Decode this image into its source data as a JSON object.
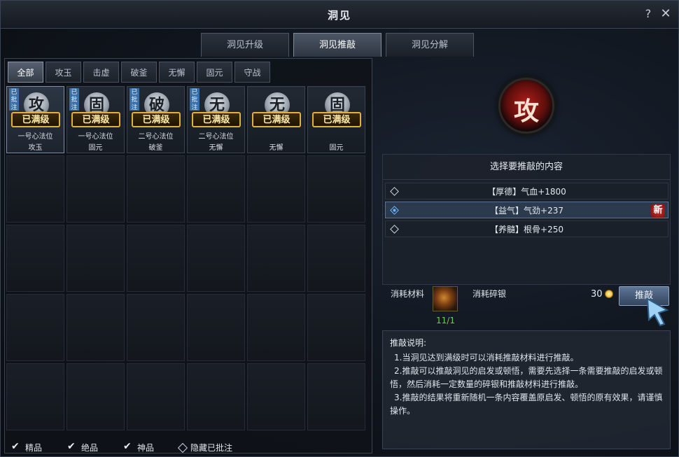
{
  "window": {
    "title": "洞见",
    "help": "?",
    "close": "✕"
  },
  "main_tabs": [
    {
      "label": "洞见升级",
      "active": false
    },
    {
      "label": "洞见推敲",
      "active": true
    },
    {
      "label": "洞见分解",
      "active": false
    }
  ],
  "category_tabs": [
    {
      "label": "全部",
      "active": true
    },
    {
      "label": "攻玉",
      "active": false
    },
    {
      "label": "击虚",
      "active": false
    },
    {
      "label": "破釜",
      "active": false
    },
    {
      "label": "无懈",
      "active": false
    },
    {
      "label": "固元",
      "active": false
    },
    {
      "label": "守战",
      "active": false
    }
  ],
  "items": [
    {
      "glyph": "攻",
      "annotated": true,
      "annot_tag": "已批注",
      "badge": "已满级",
      "slot": "一号心法位",
      "category": "攻玉",
      "selected": true
    },
    {
      "glyph": "固",
      "annotated": true,
      "annot_tag": "已批注",
      "badge": "已满级",
      "slot": "一号心法位",
      "category": "固元",
      "selected": false
    },
    {
      "glyph": "破",
      "annotated": true,
      "annot_tag": "已批注",
      "badge": "已满级",
      "slot": "二号心法位",
      "category": "破釜",
      "selected": false
    },
    {
      "glyph": "无",
      "annotated": true,
      "annot_tag": "已批注",
      "badge": "已满级",
      "slot": "二号心法位",
      "category": "无懈",
      "selected": false
    },
    {
      "glyph": "无",
      "annotated": false,
      "annot_tag": "",
      "badge": "已满级",
      "slot": "",
      "category": "无懈",
      "selected": false
    },
    {
      "glyph": "固",
      "annotated": false,
      "annot_tag": "",
      "badge": "已满级",
      "slot": "",
      "category": "固元",
      "selected": false
    }
  ],
  "filters": [
    {
      "label": "精品",
      "checked": true
    },
    {
      "label": "绝品",
      "checked": true
    },
    {
      "label": "神品",
      "checked": true
    },
    {
      "label": "隐藏已批注",
      "checked": false
    }
  ],
  "detail": {
    "emblem_glyph": "攻",
    "choice_header": "选择要推敲的内容",
    "options": [
      {
        "label": "【厚德】气血+1800",
        "selected": false,
        "is_new": false
      },
      {
        "label": "【益气】气劲+237",
        "selected": true,
        "is_new": true
      },
      {
        "label": "【养髓】根骨+250",
        "selected": false,
        "is_new": false
      }
    ],
    "new_badge": "新",
    "material_label": "消耗材料",
    "material_count": "11/1",
    "silver_label": "消耗碎银",
    "silver_amount": "30",
    "confirm_label": "推敲",
    "desc_title": "推敲说明:",
    "desc_lines": [
      "1.当洞见达到满级时可以消耗推敲材料进行推敲。",
      "2.推敲可以推敲洞见的启发或顿悟，需要先选择一条需要推敲的启发或顿悟，然后消耗一定数量的碎银和推敲材料进行推敲。",
      "3.推敲的结果将重新随机一条内容覆盖原启发、顿悟的原有效果，请谨慎操作。"
    ]
  }
}
